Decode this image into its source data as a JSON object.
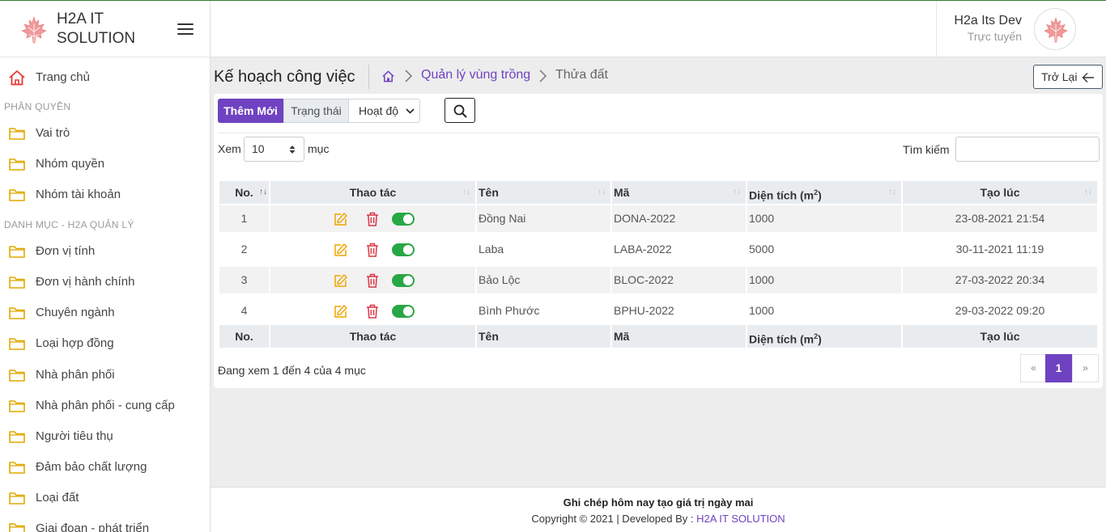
{
  "brand": {
    "line1": "H2A IT",
    "line2": "SOLUTION"
  },
  "user": {
    "name": "H2a Its Dev",
    "status": "Trực tuyến"
  },
  "sidebar": {
    "home": "Trang chủ",
    "section1": "PHÂN QUYỀN",
    "group1": [
      "Vai trò",
      "Nhóm quyền",
      "Nhóm tài khoản"
    ],
    "section2": "DANH MỤC - H2A QUẢN LÝ",
    "group2": [
      "Đơn vị tính",
      "Đơn vị hành chính",
      "Chuyên ngành",
      "Loại hợp đồng",
      "Nhà phân phối",
      "Nhà phân phối - cung cấp",
      "Người tiêu thụ",
      "Đảm bảo chất lượng",
      "Loại đất",
      "Giai đoạn - phát triển"
    ]
  },
  "page": {
    "title": "Kế hoạch công việc",
    "breadcrumb": [
      "Quản lý vùng trồng",
      "Thửa đất"
    ],
    "back": "Trở Lại"
  },
  "toolbar": {
    "add": "Thêm Mới",
    "status_label": "Trạng thái",
    "status_value": "Hoạt độ"
  },
  "table_controls": {
    "show": "Xem",
    "length": "10",
    "entries": "mục",
    "search_label": "Tìm kiếm",
    "search_value": ""
  },
  "table": {
    "headers": {
      "no": "No.",
      "actions": "Thao tác",
      "name": "Tên",
      "code": "Mã",
      "area": "Diện tích (m",
      "area_sup": "2",
      "area_close": ")",
      "created": "Tạo lúc"
    },
    "rows": [
      {
        "no": "1",
        "name": "Đồng Nai",
        "code": "DONA-2022",
        "area": "1000",
        "created": "23-08-2021 21:54",
        "active": true
      },
      {
        "no": "2",
        "name": "Laba",
        "code": "LABA-2022",
        "area": "5000",
        "created": "30-11-2021 11:19",
        "active": true
      },
      {
        "no": "3",
        "name": "Bảo Lộc",
        "code": "BLOC-2022",
        "area": "1000",
        "created": "27-03-2022 20:34",
        "active": true
      },
      {
        "no": "4",
        "name": "Bình Phước",
        "code": "BPHU-2022",
        "area": "1000",
        "created": "29-03-2022 09:20",
        "active": true
      }
    ],
    "info": "Đang xem 1 đến 4 của 4 mục"
  },
  "pagination": {
    "prev": "«",
    "current": "1",
    "next": "»"
  },
  "footer": {
    "slogan": "Ghi chép hôm nay tạo giá trị ngày mai",
    "copyright": "Copyright © 2021 | Developed By : ",
    "company": "H2A IT SOLUTION"
  },
  "colors": {
    "accent": "#6f42c1",
    "toggle_on": "#28a745",
    "edit_icon": "#f0a500",
    "delete_icon": "#dc3545",
    "logo": "#e57373"
  }
}
